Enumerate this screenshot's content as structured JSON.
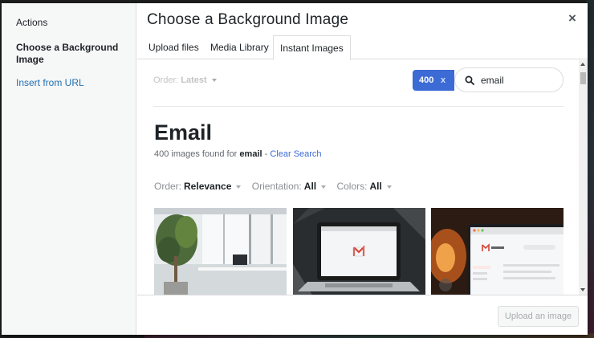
{
  "sidebar": {
    "heading": "Actions",
    "items": [
      {
        "label": "Choose a Background Image",
        "active": true
      },
      {
        "label": "Insert from URL",
        "active": false
      }
    ]
  },
  "modal": {
    "title": "Choose a Background Image",
    "close_glyph": "×"
  },
  "tabs": [
    {
      "label": "Upload files"
    },
    {
      "label": "Media Library"
    },
    {
      "label": "Instant Images",
      "active": true
    }
  ],
  "toolbar": {
    "order_label": "Order:",
    "order_value": "Latest",
    "count": "400",
    "count_clear": "x",
    "search_value": "email",
    "search_icon": "search-icon"
  },
  "results": {
    "heading": "Email",
    "found_prefix": "400 images found for",
    "found_term": "email",
    "separator": "-",
    "clear_label": "Clear Search"
  },
  "filters": [
    {
      "label": "Order:",
      "value": "Relevance"
    },
    {
      "label": "Orientation:",
      "value": "All"
    },
    {
      "label": "Colors:",
      "value": "All"
    }
  ],
  "images": [
    {
      "desc": "office-with-plants"
    },
    {
      "desc": "laptop-gmail"
    },
    {
      "desc": "laptop-gmail-inbox"
    }
  ],
  "footer": {
    "upload_label": "Upload an image"
  },
  "colors": {
    "accent": "#3c6bd5",
    "link": "#2271b1"
  }
}
